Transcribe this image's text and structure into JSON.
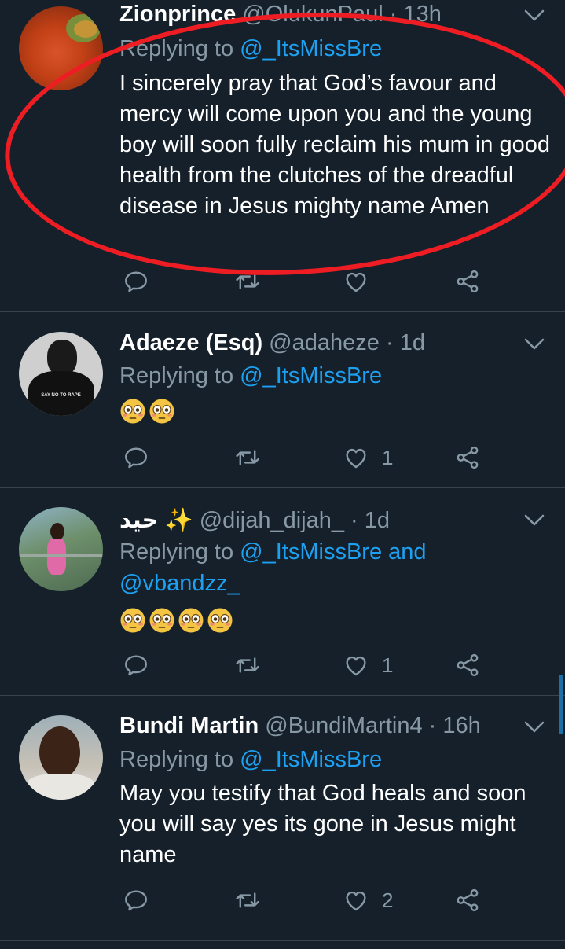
{
  "tweets": [
    {
      "name": "Zionprince",
      "handle": "@OlukunPaul",
      "time": "13h",
      "reply_prefix": "Replying to",
      "reply_to": "@_ItsMissBre",
      "reply_to_2": "",
      "text": "I sincerely pray that God’s favour and mercy will come upon you and the young boy will soon fully reclaim his mum in good health from the clutches of the dreadful disease in Jesus mighty name Amen",
      "likes": ""
    },
    {
      "name": "Adaeze (Esq)",
      "handle": "@adaheze",
      "time": "1d",
      "reply_prefix": "Replying to",
      "reply_to": "@_ItsMissBre",
      "emoji_count": 2,
      "likes": "1",
      "avatar_text": "SAY NO TO RAPE"
    },
    {
      "name": "حيد",
      "name_emoji": "✨",
      "handle": "@dijah_dijah_",
      "time": "1d",
      "reply_prefix": "Replying to",
      "reply_to": "@_ItsMissBre",
      "reply_and": "and",
      "reply_to_2": "@vbandzz_",
      "emoji_count": 4,
      "likes": "1"
    },
    {
      "name": "Bundi Martin",
      "handle": "@BundiMartin4",
      "time": "16h",
      "reply_prefix": "Replying to",
      "reply_to": "@_ItsMissBre",
      "text": "May you testify that God heals and soon you will say yes its gone in Jesus might name",
      "likes": "2"
    }
  ],
  "separator": "·",
  "colors": {
    "bg": "#15202b",
    "muted": "#8899a6",
    "accent": "#1da1f2",
    "annotation": "#ee1d24"
  },
  "icons": [
    "reply-icon",
    "retweet-icon",
    "like-icon",
    "share-icon",
    "chevron-down-icon",
    "flushed-face-emoji"
  ]
}
